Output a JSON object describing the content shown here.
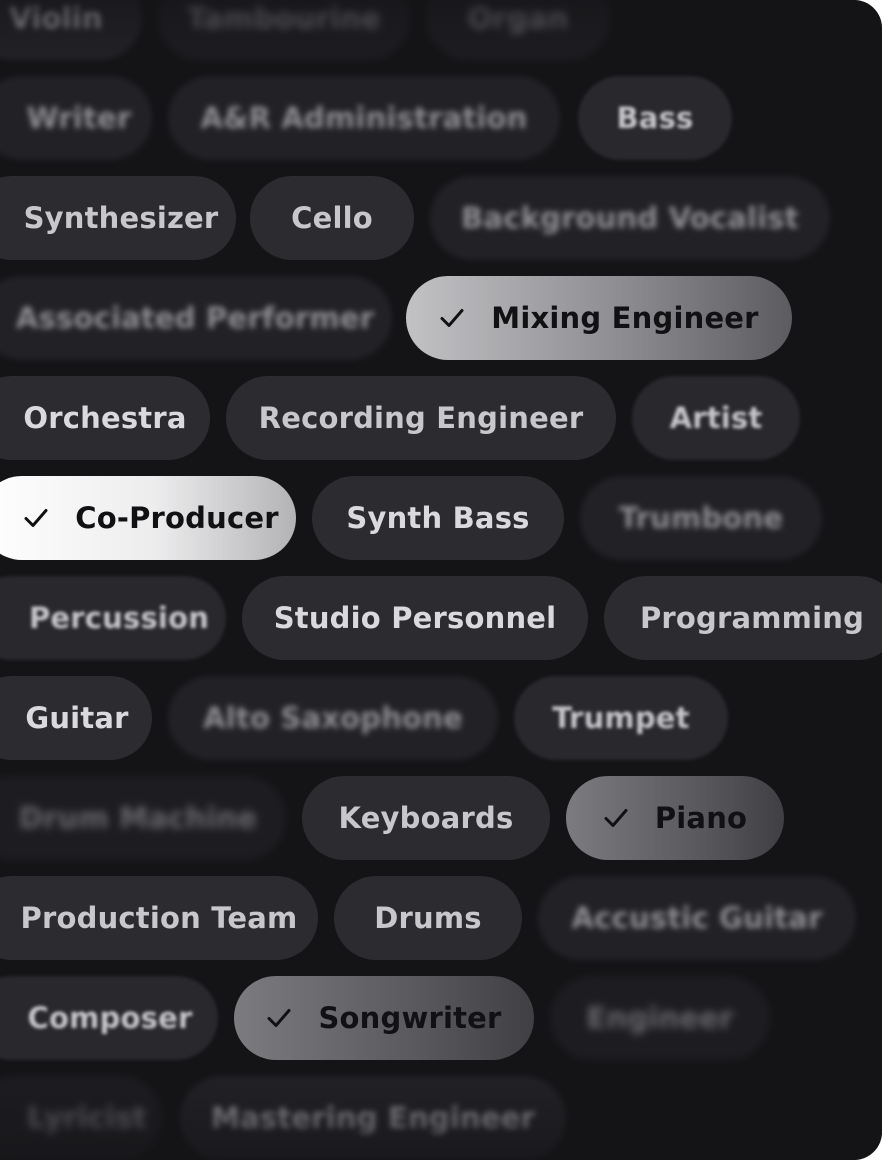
{
  "roles": {
    "r0": [
      "Violin",
      "Tambourine",
      "Organ"
    ],
    "r1": [
      "Writer",
      "A&R Administration",
      "Bass"
    ],
    "r2": [
      "Synthesizer",
      "Cello",
      "Background Vocalist"
    ],
    "r3": [
      "Associated Performer",
      "Mixing Engineer"
    ],
    "r4": [
      "Orchestra",
      "Recording Engineer",
      "Artist"
    ],
    "r5": [
      "Co-Producer",
      "Synth Bass",
      "Trumbone"
    ],
    "r6": [
      "Percussion",
      "Studio Personnel",
      "Programming"
    ],
    "r7": [
      "Guitar",
      "Alto Saxophone",
      "Trumpet"
    ],
    "r8": [
      "Drum Machine",
      "Keyboards",
      "Piano"
    ],
    "r9": [
      "Production Team",
      "Drums",
      "Accustic Guitar"
    ],
    "r10": [
      "Composer",
      "Songwriter",
      "Engineer"
    ],
    "r11": [
      "Lyricist",
      "Mastering Engineer"
    ]
  },
  "selected": [
    "Mixing Engineer",
    "Co-Producer",
    "Piano",
    "Songwriter"
  ],
  "icons": {
    "selected_mark": "check-icon"
  },
  "colors": {
    "background": "#141417",
    "chip": "#2b2b30",
    "chip_text": "#d9d9de",
    "selected_text": "#111114"
  }
}
